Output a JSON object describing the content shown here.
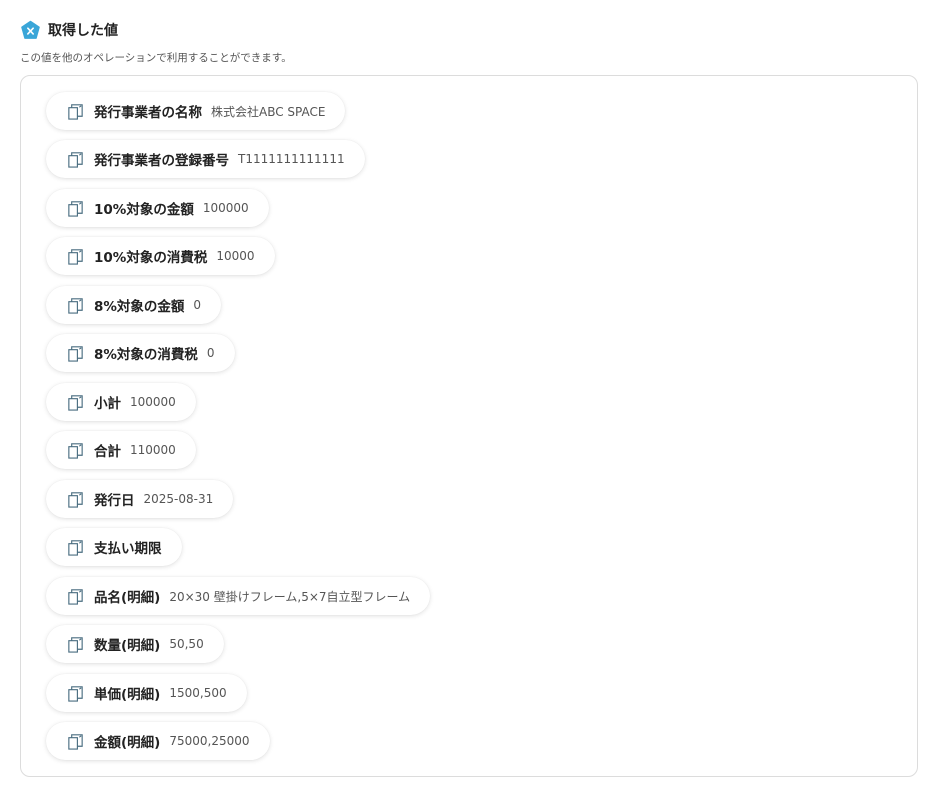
{
  "header": {
    "title": "取得した値",
    "subtitle": "この値を他のオペレーションで利用することができます。"
  },
  "items": [
    {
      "label": "発行事業者の名称",
      "value": "株式会社ABC SPACE"
    },
    {
      "label": "発行事業者の登録番号",
      "value": "T1111111111111"
    },
    {
      "label": "10%対象の金額",
      "value": "100000"
    },
    {
      "label": "10%対象の消費税",
      "value": "10000"
    },
    {
      "label": "8%対象の金額",
      "value": "0"
    },
    {
      "label": "8%対象の消費税",
      "value": "0"
    },
    {
      "label": "小計",
      "value": "100000"
    },
    {
      "label": "合計",
      "value": "110000"
    },
    {
      "label": "発行日",
      "value": "2025-08-31"
    },
    {
      "label": "支払い期限",
      "value": ""
    },
    {
      "label": "品名(明細)",
      "value": "20×30 壁掛けフレーム,5×7自立型フレーム"
    },
    {
      "label": "数量(明細)",
      "value": "50,50"
    },
    {
      "label": "単価(明細)",
      "value": "1500,500"
    },
    {
      "label": "金額(明細)",
      "value": "75000,25000"
    }
  ],
  "colors": {
    "accent": "#3aa6d8",
    "icon_stroke": "#4a6d80"
  }
}
